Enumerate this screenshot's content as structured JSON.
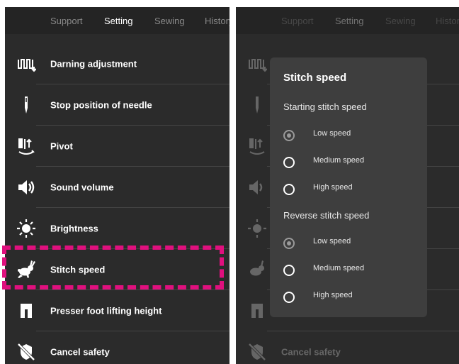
{
  "tabs": [
    "Support",
    "Setting",
    "Sewing",
    "History"
  ],
  "active_tab": "Setting",
  "menu": [
    {
      "label": "Darning adjustment",
      "icon": "darning-icon"
    },
    {
      "label": "Stop position of needle",
      "icon": "needle-icon"
    },
    {
      "label": "Pivot",
      "icon": "pivot-icon"
    },
    {
      "label": "Sound volume",
      "icon": "speaker-icon"
    },
    {
      "label": "Brightness",
      "icon": "sun-icon"
    },
    {
      "label": "Stitch speed",
      "icon": "rabbit-icon"
    },
    {
      "label": "Presser foot lifting height",
      "icon": "presser-foot-icon"
    },
    {
      "label": "Cancel safety",
      "icon": "cancel-safety-icon"
    }
  ],
  "highlighted_item": "Stitch speed",
  "dialog": {
    "title": "Stitch speed",
    "start_section": "Starting stitch speed",
    "start_options": [
      "Low speed",
      "Medium speed",
      "High speed"
    ],
    "start_selected": "Low speed",
    "reverse_section": "Reverse stitch speed",
    "reverse_options": [
      "Low speed",
      "Medium speed",
      "High speed"
    ],
    "reverse_selected": "Low speed"
  },
  "colors": {
    "panel": "#2b2b2b",
    "dialog": "#3e3e3e",
    "highlight": "#e0107e",
    "text": "#ffffff"
  }
}
